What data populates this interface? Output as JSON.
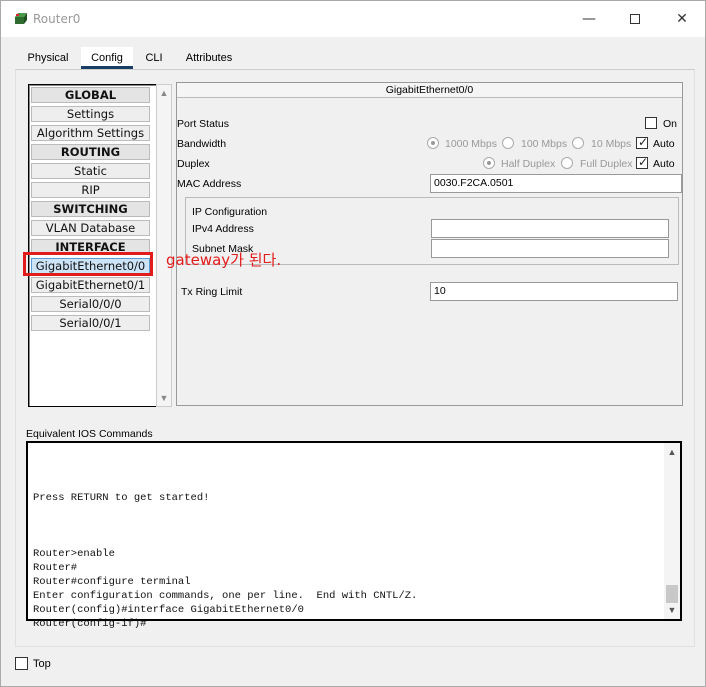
{
  "window": {
    "title": "Router0"
  },
  "tabs": [
    {
      "label": "Physical"
    },
    {
      "label": "Config"
    },
    {
      "label": "CLI"
    },
    {
      "label": "Attributes"
    }
  ],
  "sidebar": {
    "items": [
      {
        "label": "GLOBAL",
        "header": true
      },
      {
        "label": "Settings"
      },
      {
        "label": "Algorithm Settings"
      },
      {
        "label": "ROUTING",
        "header": true
      },
      {
        "label": "Static"
      },
      {
        "label": "RIP"
      },
      {
        "label": "SWITCHING",
        "header": true
      },
      {
        "label": "VLAN Database"
      },
      {
        "label": "INTERFACE",
        "header": true
      },
      {
        "label": "GigabitEthernet0/0",
        "selected": true
      },
      {
        "label": "GigabitEthernet0/1"
      },
      {
        "label": "Serial0/0/0"
      },
      {
        "label": "Serial0/0/1"
      }
    ]
  },
  "panel": {
    "title": "GigabitEthernet0/0",
    "port_status_label": "Port Status",
    "port_on_label": "On",
    "bandwidth_label": "Bandwidth",
    "bandwidth_options": [
      "1000 Mbps",
      "100 Mbps",
      "10 Mbps"
    ],
    "bandwidth_auto_label": "Auto",
    "duplex_label": "Duplex",
    "duplex_options": [
      "Half Duplex",
      "Full Duplex"
    ],
    "duplex_auto_label": "Auto",
    "mac_label": "MAC Address",
    "mac_value": "0030.F2CA.0501",
    "ip_config_label": "IP Configuration",
    "ipv4_label": "IPv4 Address",
    "ipv4_value": "",
    "subnet_label": "Subnet Mask",
    "subnet_value": "",
    "tx_ring_label": "Tx Ring Limit",
    "tx_ring_value": "10"
  },
  "annotation": {
    "text": "gateway가 된다."
  },
  "ios": {
    "label": "Equivalent IOS Commands",
    "lines": [
      "",
      "",
      "",
      "Press RETURN to get started!",
      "",
      "",
      "",
      "Router>enable",
      "Router#",
      "Router#configure terminal",
      "Enter configuration commands, one per line.  End with CNTL/Z.",
      "Router(config)#interface GigabitEthernet0/0",
      "Router(config-if)#"
    ]
  },
  "footer": {
    "top_label": "Top"
  }
}
